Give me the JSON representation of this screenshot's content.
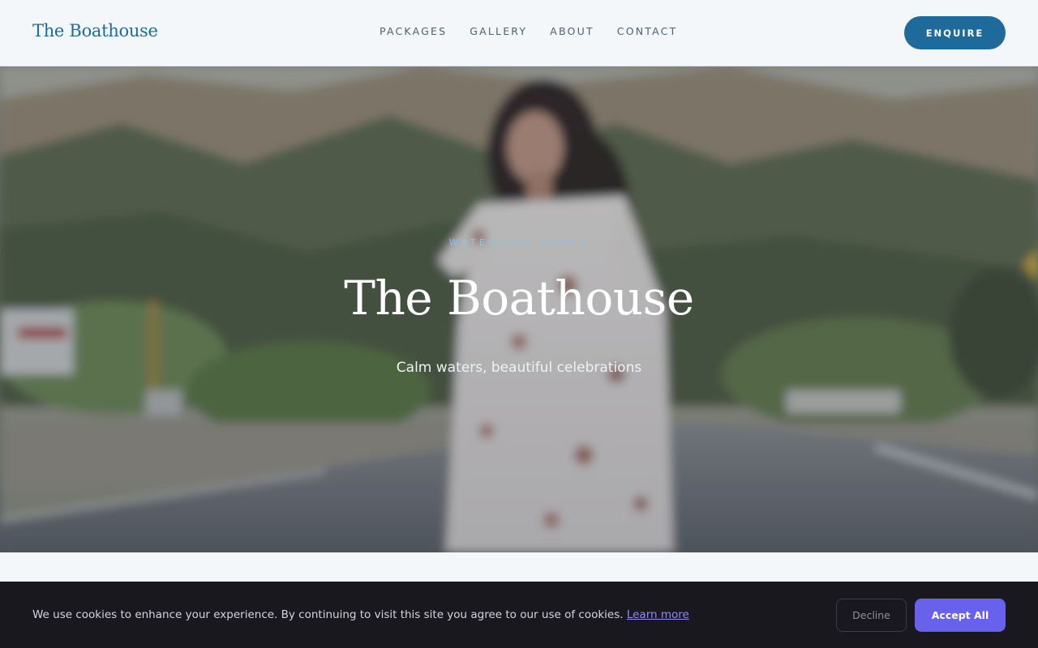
{
  "header": {
    "logo": "The Boathouse",
    "nav": [
      {
        "label": "PACKAGES"
      },
      {
        "label": "GALLERY"
      },
      {
        "label": "ABOUT"
      },
      {
        "label": "CONTACT"
      }
    ],
    "cta_label": "ENQUIRE"
  },
  "hero": {
    "eyebrow": "WATERSIDE VENUE",
    "title": "The Boathouse",
    "subtitle": "Calm waters, beautiful celebrations",
    "image_description_icon": "hero-photo"
  },
  "cookie_banner": {
    "message": "We use cookies to enhance your experience. By continuing to visit this site you agree to our use of cookies.",
    "link_label": "Learn more",
    "decline_label": "Decline",
    "accept_label": "Accept All"
  },
  "colors": {
    "brand": "#1d6a9b",
    "accent": "#6861ec",
    "cookie_bg": "#18181e"
  }
}
